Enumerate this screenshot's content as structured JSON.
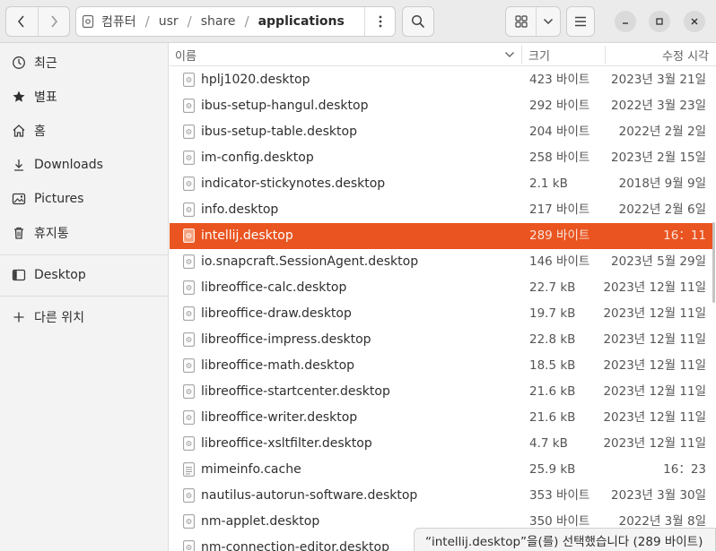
{
  "nav": {
    "back_icon": "chevron-left-icon",
    "forward_icon": "chevron-right-icon"
  },
  "path": {
    "root_icon": "drive-icon",
    "segments": [
      "컴퓨터",
      "usr",
      "share",
      "applications"
    ]
  },
  "colors": {
    "accent": "#e95420",
    "sidebar_bg": "#f3f3f3",
    "header_bg": "#ebebeb"
  },
  "sidebar": {
    "items": [
      {
        "label": "최근",
        "icon": "clock-icon"
      },
      {
        "label": "별표",
        "icon": "star-icon"
      },
      {
        "label": "홈",
        "icon": "home-icon"
      },
      {
        "label": "Downloads",
        "icon": "download-icon"
      },
      {
        "label": "Pictures",
        "icon": "picture-icon"
      },
      {
        "label": "휴지통",
        "icon": "trash-icon"
      },
      {
        "label": "Desktop",
        "icon": "desktop-icon"
      },
      {
        "label": "다른 위치",
        "icon": "plus-icon"
      }
    ]
  },
  "columns": {
    "name": "이름",
    "size": "크기",
    "modified": "수정 시각"
  },
  "files": [
    {
      "name": "hplj1020.desktop",
      "size": "423 바이트",
      "date": "2023년 3월 21일"
    },
    {
      "name": "ibus-setup-hangul.desktop",
      "size": "292 바이트",
      "date": "2022년 3월 23일"
    },
    {
      "name": "ibus-setup-table.desktop",
      "size": "204 바이트",
      "date": "2022년 2월 2일"
    },
    {
      "name": "im-config.desktop",
      "size": "258 바이트",
      "date": "2023년 2월 15일"
    },
    {
      "name": "indicator-stickynotes.desktop",
      "size": "2.1 kB",
      "date": "2018년 9월 9일"
    },
    {
      "name": "info.desktop",
      "size": "217 바이트",
      "date": "2022년 2월 6일"
    },
    {
      "name": "intellij.desktop",
      "size": "289 바이트",
      "date": "16：11",
      "selected": true
    },
    {
      "name": "io.snapcraft.SessionAgent.desktop",
      "size": "146 바이트",
      "date": "2023년 5월 29일"
    },
    {
      "name": "libreoffice-calc.desktop",
      "size": "22.7 kB",
      "date": "2023년 12월 11일"
    },
    {
      "name": "libreoffice-draw.desktop",
      "size": "19.7 kB",
      "date": "2023년 12월 11일"
    },
    {
      "name": "libreoffice-impress.desktop",
      "size": "22.8 kB",
      "date": "2023년 12월 11일"
    },
    {
      "name": "libreoffice-math.desktop",
      "size": "18.5 kB",
      "date": "2023년 12월 11일"
    },
    {
      "name": "libreoffice-startcenter.desktop",
      "size": "21.6 kB",
      "date": "2023년 12월 11일"
    },
    {
      "name": "libreoffice-writer.desktop",
      "size": "21.6 kB",
      "date": "2023년 12월 11일"
    },
    {
      "name": "libreoffice-xsltfilter.desktop",
      "size": "4.7 kB",
      "date": "2023년 12월 11일"
    },
    {
      "name": "mimeinfo.cache",
      "size": "25.9 kB",
      "date": "16：23",
      "kind": "text"
    },
    {
      "name": "nautilus-autorun-software.desktop",
      "size": "353 바이트",
      "date": "2023년 3월 30일"
    },
    {
      "name": "nm-applet.desktop",
      "size": "350 바이트",
      "date": "2022년 3월 8일"
    },
    {
      "name": "nm-connection-editor.desktop",
      "size": "",
      "date": ""
    }
  ],
  "status": {
    "text": "“intellij.desktop”을(를) 선택했습니다 (289 바이트)"
  }
}
